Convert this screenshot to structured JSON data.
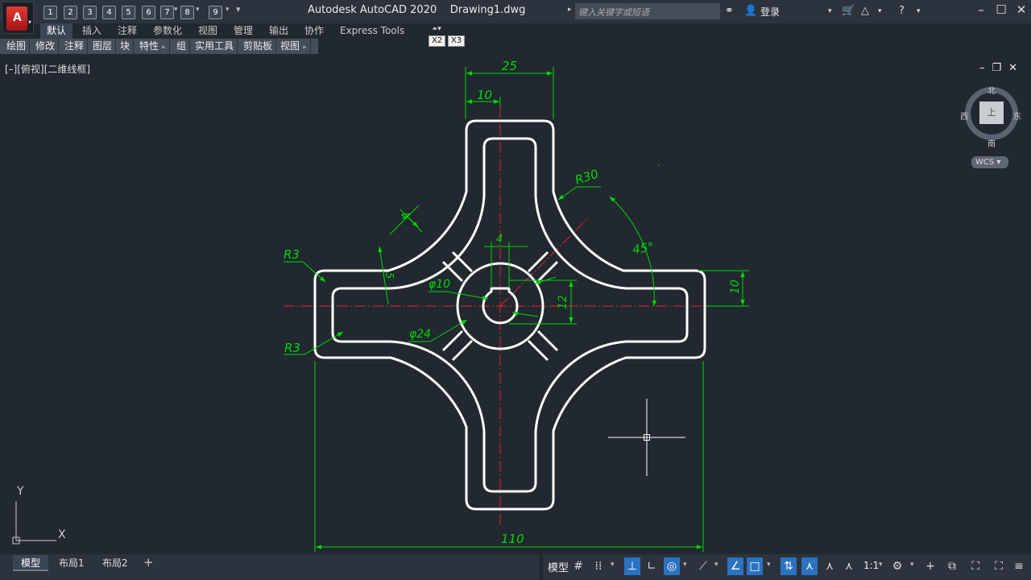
{
  "window": {
    "app_letter": "A",
    "title": "Autodesk AutoCAD 2020    Drawing1.dwg",
    "search_placeholder": "键入关键字或短语",
    "login_label": "登录"
  },
  "quick_access": [
    "1",
    "2",
    "3",
    "4",
    "5",
    "6",
    "7",
    "8",
    "9"
  ],
  "ribbon_tabs": [
    "默认",
    "插入",
    "注释",
    "参数化",
    "视图",
    "管理",
    "输出",
    "协作",
    "Express Tools"
  ],
  "ribbon_badges": [
    "X2",
    "X3"
  ],
  "panels": [
    "绘图",
    "修改",
    "注释",
    "图层",
    "块",
    "特性",
    "组",
    "实用工具",
    "剪贴板",
    "视图"
  ],
  "viewport": {
    "label": "[–][俯视][二维线框]",
    "viewcube": {
      "north": "北",
      "south": "南",
      "east": "东",
      "west": "西",
      "face": "上",
      "wcs": "WCS"
    },
    "ucs": {
      "y": "Y",
      "x": "X"
    }
  },
  "dimensions": {
    "d25": "25",
    "d10_top": "10",
    "r30": "R30",
    "d4_left": "4",
    "d4_key": "4",
    "a45": "45°",
    "r3_top": "R3",
    "d5": "5",
    "dia10": "φ10",
    "d12": "12",
    "d10_right": "10",
    "dia24": "φ24",
    "r3_bottom": "R3",
    "d110": "110"
  },
  "layout_tabs": [
    "模型",
    "布局1",
    "布局2"
  ],
  "status": {
    "model": "模型",
    "scale": "1:1"
  },
  "colors": {
    "background": "#212830",
    "geometry": "#ffffff",
    "dimension": "#00d700",
    "centerline": "#e4202a",
    "accent": "#2b72c0"
  }
}
